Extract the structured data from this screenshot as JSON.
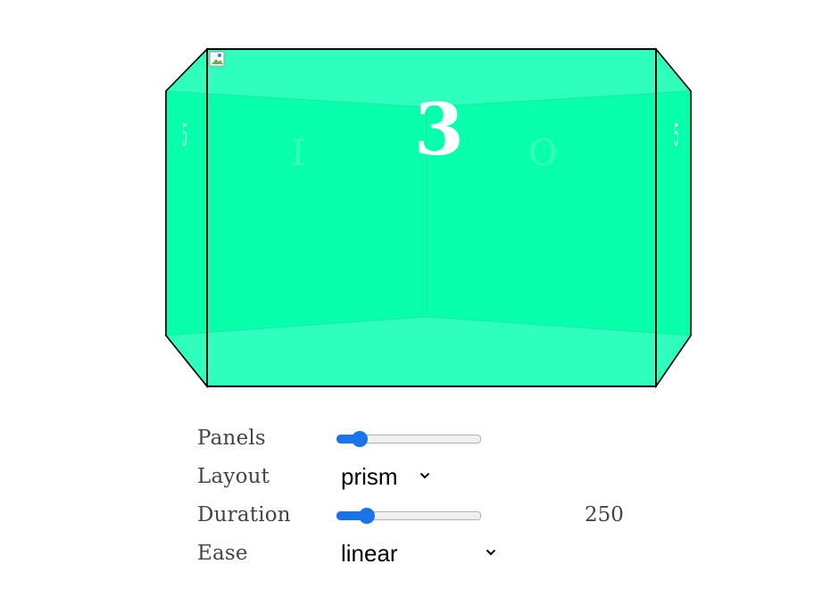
{
  "viewer": {
    "panel_number": "3",
    "ghost_left_glyph": "I",
    "ghost_right_glyph": "O",
    "edge_left_glyph": "5",
    "edge_right_glyph": "5",
    "panel_color": "#0affae",
    "broken_image_icon": "broken-image-icon"
  },
  "controls": {
    "panels": {
      "label": "Panels",
      "value_fraction": 0.16
    },
    "layout": {
      "label": "Layout",
      "selected": "prism"
    },
    "duration": {
      "label": "Duration",
      "value": "250",
      "value_fraction": 0.21
    },
    "ease": {
      "label": "Ease",
      "selected": "linear"
    }
  },
  "colors": {
    "accent": "#1a73e8",
    "label_text": "#444444"
  }
}
